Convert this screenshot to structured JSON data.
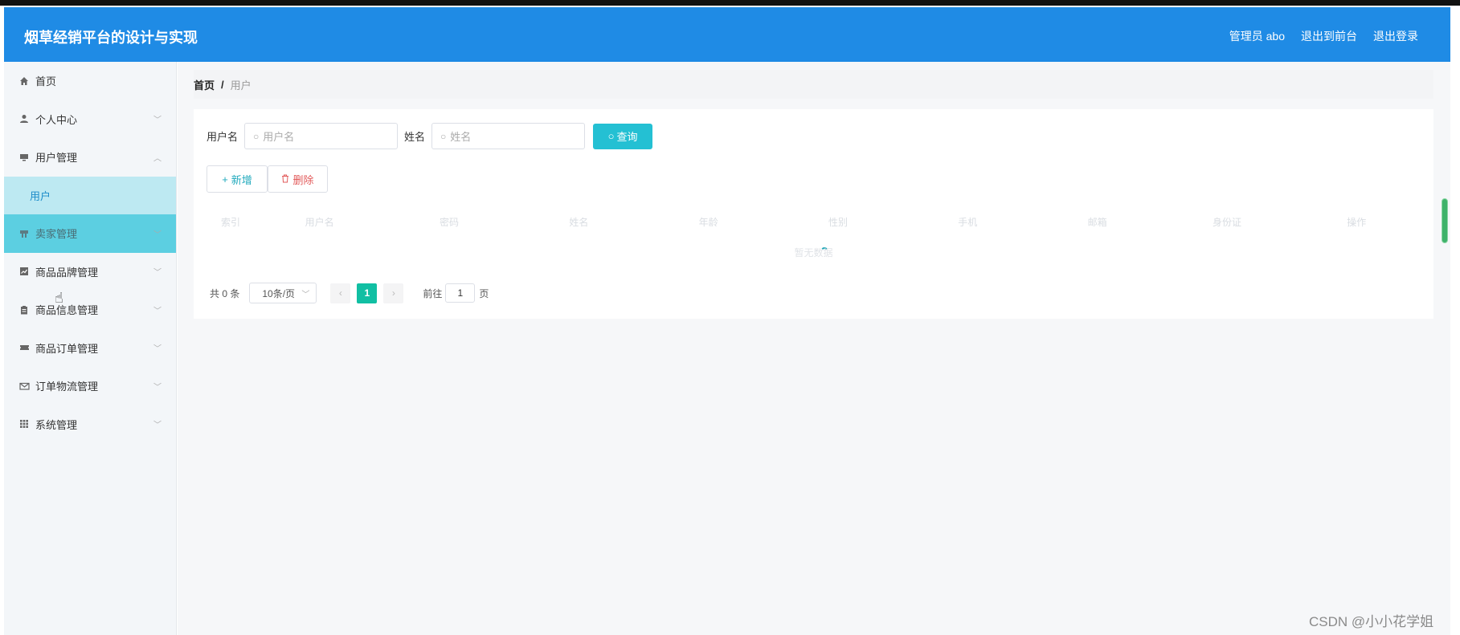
{
  "header": {
    "title": "烟草经销平台的设计与实现",
    "admin_label": "管理员 abo",
    "front_link": "退出到前台",
    "logout_link": "退出登录"
  },
  "sidebar": {
    "items": [
      {
        "label": "首页",
        "icon": "home-icon"
      },
      {
        "label": "个人中心",
        "icon": "user-icon"
      },
      {
        "label": "用户管理",
        "icon": "monitor-icon"
      },
      {
        "label": "用户",
        "icon": ""
      },
      {
        "label": "卖家管理",
        "icon": "desk-icon"
      },
      {
        "label": "商品品牌管理",
        "icon": "chart-icon"
      },
      {
        "label": "商品信息管理",
        "icon": "clipboard-icon"
      },
      {
        "label": "商品订单管理",
        "icon": "ticket-icon"
      },
      {
        "label": "订单物流管理",
        "icon": "mail-icon"
      },
      {
        "label": "系统管理",
        "icon": "grid-icon"
      }
    ]
  },
  "breadcrumb": {
    "home": "首页",
    "separator": "/",
    "current": "用户"
  },
  "search": {
    "username_label": "用户名",
    "username_placeholder": "用户名",
    "name_label": "姓名",
    "name_placeholder": "姓名",
    "query_button": "查询"
  },
  "actions": {
    "add_button": "新增",
    "delete_button": "删除"
  },
  "table": {
    "columns": [
      "索引",
      "用户名",
      "密码",
      "姓名",
      "年龄",
      "性别",
      "手机",
      "邮箱",
      "身份证",
      "操作"
    ],
    "empty_text": "暂无数据"
  },
  "pagination": {
    "total": "共 0 条",
    "page_size": "10条/页",
    "current_page": "1",
    "goto_label": "前往",
    "goto_value": "1",
    "page_suffix": "页"
  },
  "watermark": "CSDN @小小花学姐"
}
